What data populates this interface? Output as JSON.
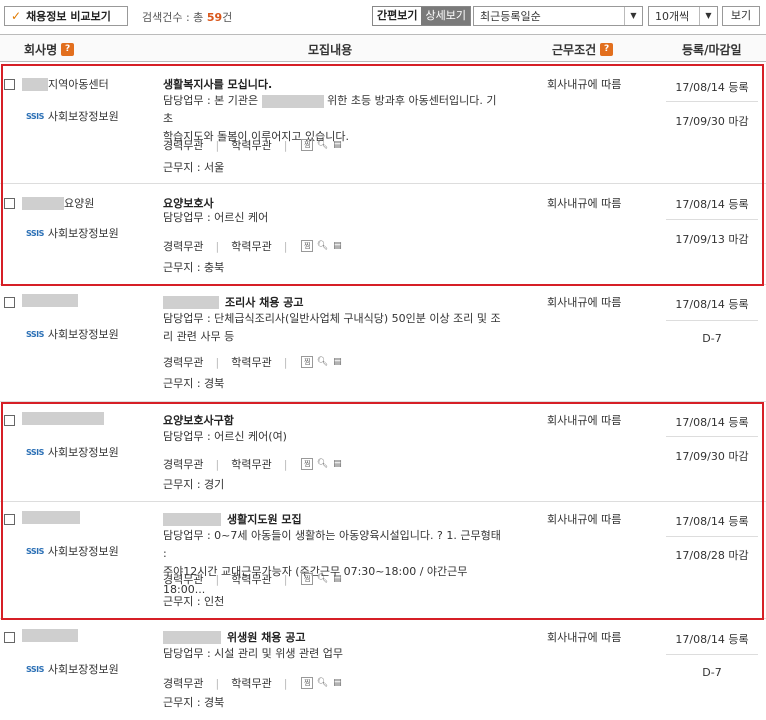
{
  "toolbar": {
    "compare_label": "채용정보 비교보기",
    "count_prefix": "검색건수 : 총",
    "count_value": "59",
    "count_suffix": "건",
    "view_simple": "간편보기",
    "view_detail": "상세보기",
    "sort_value": "최근등록일순",
    "perpage_value": "10개씩",
    "view_button": "보기"
  },
  "header": {
    "company": "회사명",
    "content": "모집내용",
    "condition": "근무조건",
    "dates": "등록/마감일"
  },
  "rows": [
    {
      "company_suffix": "지역아동센터",
      "org": "사회보장정보원",
      "title": "생활복지사를 모십니다.",
      "duty_a": "담당업무 : 본 기관은",
      "duty_b": "위한 초등 방과후 아동센터입니다. 기초",
      "duty_c": "학습지도와 돌봄이 이루어지고 있습니다.",
      "career": "경력무관",
      "edu": "학력무관",
      "location": "근무지 : 서울",
      "condition": "회사내규에 따름",
      "reg": "17/08/14 등록",
      "deadline": "17/09/30 마감"
    },
    {
      "company_suffix": "요양원",
      "org": "사회보장정보원",
      "title": "요양보호사",
      "duty_a": "담당업무 : 어르신 케어",
      "career": "경력무관",
      "edu": "학력무관",
      "location": "근무지 : 충북",
      "condition": "회사내규에 따름",
      "reg": "17/08/14 등록",
      "deadline": "17/09/13 마감"
    },
    {
      "org": "사회보장정보원",
      "title": "조리사 채용 공고",
      "duty_a": "담당업무 : 단체급식조리사(일반사업체 구내식당) 50인분 이상 조리 및 조",
      "duty_b": "리 관련 사무 등",
      "career": "경력무관",
      "edu": "학력무관",
      "location": "근무지 : 경북",
      "condition": "회사내규에 따름",
      "reg": "17/08/14 등록",
      "deadline": "D-7"
    },
    {
      "org": "사회보장정보원",
      "title": "요양보호사구함",
      "duty_a": "담당업무 : 어르신 케어(여)",
      "career": "경력무관",
      "edu": "학력무관",
      "location": "근무지 : 경기",
      "condition": "회사내규에 따름",
      "reg": "17/08/14 등록",
      "deadline": "17/09/30 마감"
    },
    {
      "org": "사회보장정보원",
      "title": "생활지도원 모집",
      "duty_a": "담당업무 : 0~7세 아동들이 생활하는 아동양육시설입니다. ? 1. 근무형태 :",
      "duty_b": "주야12시간 교대근무가능자 (주간근무 07:30~18:00 / 야간근무 18:00...",
      "career": "경력무관",
      "edu": "학력무관",
      "location": "근무지 : 인천",
      "condition": "회사내규에 따름",
      "reg": "17/08/14 등록",
      "deadline": "17/08/28 마감"
    },
    {
      "org": "사회보장정보원",
      "title": "위생원 채용 공고",
      "duty_a": "담당업무 : 시설 관리 및 위생 관련 업무",
      "career": "경력무관",
      "edu": "학력무관",
      "location": "근무지 : 경북",
      "condition": "회사내규에 따름",
      "reg": "17/08/14 등록",
      "deadline": "D-7"
    }
  ],
  "icons": {
    "check": "check-icon",
    "help": "help-icon",
    "scrap": "scrap-icon",
    "search": "magnifier-icon",
    "detail": "detail-icon"
  },
  "colors": {
    "highlight": "#d61f26",
    "count_accent": "#d9571b",
    "help_badge": "#e26f1e"
  }
}
